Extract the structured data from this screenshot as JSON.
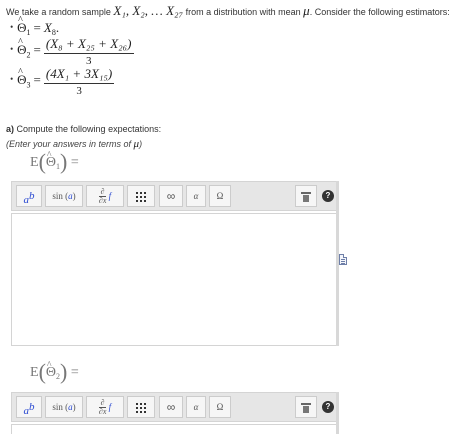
{
  "intro": {
    "prefix": "We take a random sample ",
    "sample": "X₁, X₂, … X₂₇",
    "mid": " from a distribution with mean ",
    "mean_symbol": "μ",
    "suffix": ". Consider the following estimators:"
  },
  "estimators": [
    {
      "name": "Θ",
      "sub": "1",
      "rhs_var": "X",
      "rhs_sub": "8",
      "rhs_tail": "."
    },
    {
      "name": "Θ",
      "sub": "2",
      "numerator": "(X₈ + X₂₅ + X₂₆)",
      "denominator": "3"
    },
    {
      "name": "Θ",
      "sub": "3",
      "numerator": "(4X₁ + 3X₁₅)",
      "denominator": "3"
    }
  ],
  "part_a": {
    "label_bold": "a)",
    "label_text": " Compute the following expectations:",
    "hint_prefix": "(Enter your answers in terms of ",
    "hint_symbol": "μ",
    "hint_suffix": ")"
  },
  "expectations": [
    {
      "operator": "E",
      "name": "Θ",
      "sub": "1",
      "equals": "="
    },
    {
      "operator": "E",
      "name": "Θ",
      "sub": "2",
      "equals": "="
    }
  ],
  "toolbar": {
    "power_base": "a",
    "power_exp": "b",
    "sin_label": "sin",
    "sin_arg": "a",
    "deriv_top": "∂",
    "deriv_bottom": "∂x",
    "deriv_func": "f",
    "infinity": "∞",
    "alpha": "α",
    "omega": "Ω",
    "help": "?",
    "icons": [
      "matrix-icon",
      "trash-icon",
      "help-icon"
    ]
  },
  "colors": {
    "accent": "#2b4ad1",
    "toolbar_bg": "#e6e6e6"
  }
}
